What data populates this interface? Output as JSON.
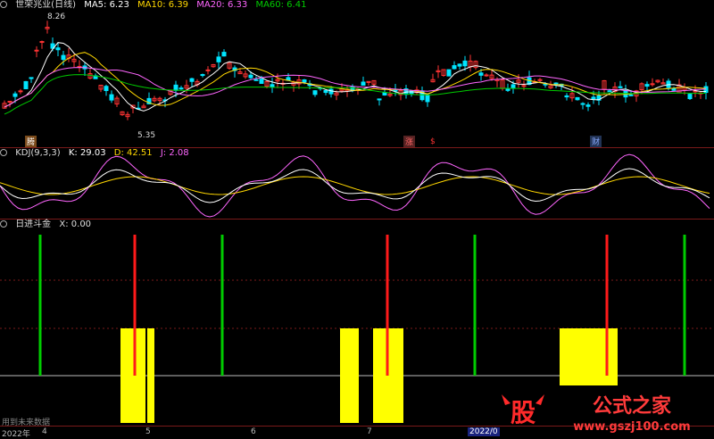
{
  "main": {
    "title": "世荣兆业(日线)",
    "ma5_label": "MA5: 6.23",
    "ma10_label": "MA10: 6.39",
    "ma20_label": "MA20: 6.33",
    "ma60_label": "MA60: 6.41",
    "high_label": "8.26",
    "low_label": "5.35",
    "tags": [
      "腾",
      "涨",
      "$",
      "财"
    ]
  },
  "kdj": {
    "title": "KDJ(9,3,3)",
    "k_label": "K: 29.03",
    "d_label": "D: 42.51",
    "j_label": "J: 2.08"
  },
  "indicator": {
    "title": "日进斗金",
    "x_label": "X: 0.00",
    "note": "用到未来数据"
  },
  "x_axis": [
    "2022年",
    "4",
    "5",
    "6",
    "7",
    "2022/0"
  ],
  "watermark": {
    "text1": "股",
    "text2": "公式之家",
    "url": "www.gszj100.com"
  },
  "colors": {
    "bg": "#000000",
    "up": "#ff3333",
    "down": "#00e5ff",
    "ma5": "#ffffff",
    "ma10": "#ffd700",
    "ma20": "#ff66ff",
    "ma60": "#00cc00",
    "green_signal": "#00cc00",
    "red_signal": "#ff1a1a",
    "yellow_bar": "#ffff00"
  },
  "chart_data": {
    "type": "bar",
    "title": "日进斗金",
    "signals_green_x_index": [
      1,
      6,
      13,
      19
    ],
    "signals_red_x_index": [
      3,
      11,
      17
    ],
    "yellow_blocks": [
      {
        "from": 3,
        "to": 4,
        "low_extend": true
      },
      {
        "from": 9,
        "to": 10,
        "low_extend": true
      },
      {
        "from": 15,
        "to": 16,
        "low_extend": false
      }
    ]
  }
}
